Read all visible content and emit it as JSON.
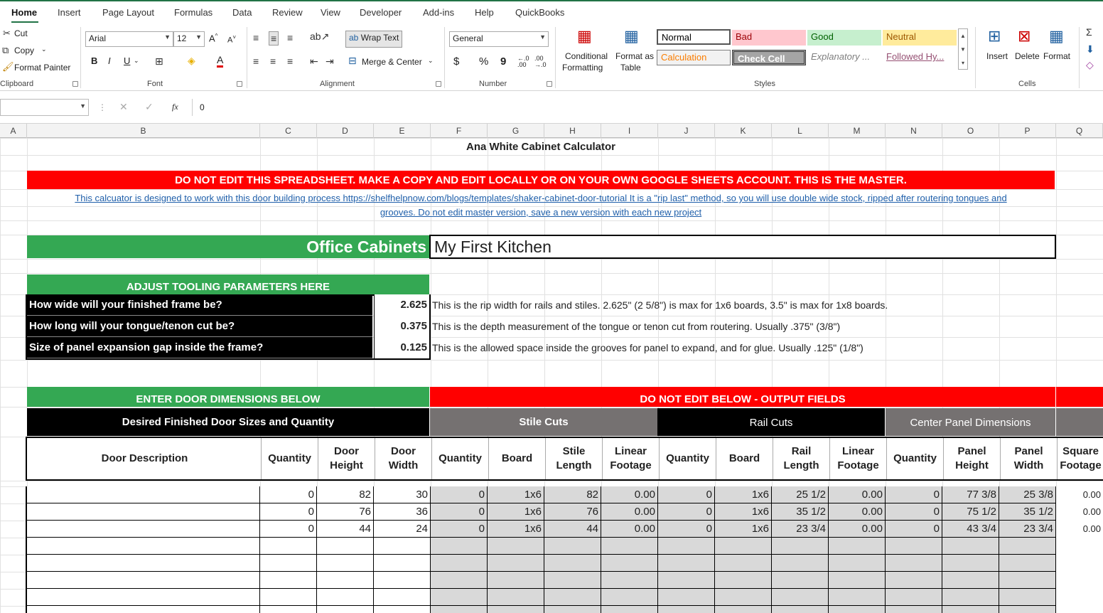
{
  "tabs": [
    "Home",
    "Insert",
    "Page Layout",
    "Formulas",
    "Data",
    "Review",
    "View",
    "Developer",
    "Add-ins",
    "Help",
    "QuickBooks"
  ],
  "ribbon": {
    "clipboard": {
      "cut": "Cut",
      "copy": "Copy",
      "format_painter": "Format Painter",
      "label": "Clipboard"
    },
    "font": {
      "name": "Arial",
      "size": "12",
      "bold": "B",
      "italic": "I",
      "underline": "U",
      "grow": "A^",
      "shrink": "A˅",
      "label": "Font"
    },
    "alignment": {
      "wrap": "Wrap Text",
      "merge": "Merge & Center",
      "label": "Alignment"
    },
    "number": {
      "format": "General",
      "currency": "$",
      "percent": "%",
      "comma": "9",
      "inc": "←.0 .00",
      "dec": ".00 →.0",
      "label": "Number"
    },
    "styles": {
      "cond_line1": "Conditional",
      "cond_line2": "Formatting",
      "table_line1": "Format as",
      "table_line2": "Table",
      "normal": "Normal",
      "bad": "Bad",
      "good": "Good",
      "neutral": "Neutral",
      "calculation": "Calculation",
      "check": "Check Cell",
      "explanatory": "Explanatory ...",
      "followed": "Followed Hy...",
      "label": "Styles"
    },
    "cells": {
      "insert": "Insert",
      "delete": "Delete",
      "format": "Format",
      "label": "Cells"
    }
  },
  "formula_bar": {
    "name_box": "",
    "fx": "fx",
    "value": "0"
  },
  "columns": [
    "A",
    "B",
    "C",
    "D",
    "E",
    "F",
    "G",
    "H",
    "I",
    "J",
    "K",
    "L",
    "M",
    "N",
    "O",
    "P",
    "Q"
  ],
  "sheet": {
    "title": "Ana White Cabinet Calculator",
    "warning": "DO NOT EDIT THIS SPREADSHEET. MAKE A COPY AND EDIT LOCALLY OR ON YOUR OWN GOOGLE SHEETS ACCOUNT. THIS IS THE MASTER.",
    "info_line1": "This calcuator is designed to work with this door building process https://shelfhelpnow.com/blogs/templates/shaker-cabinet-door-tutorial It is a \"rip last\" method, so you will use double wide stock, ripped after routering tongues and",
    "info_line2": "grooves. Do not edit master version, save a new version with each new project",
    "project_label": "Office Cabinets",
    "project_name": "My First Kitchen",
    "tooling_header": "ADJUST TOOLING PARAMETERS HERE",
    "params": [
      {
        "q": "How wide will your finished frame be?",
        "v": "2.625",
        "note": "This is the rip width for rails and stiles. 2.625\" (2 5/8\") is max for 1x6 boards, 3.5\" is max for 1x8 boards."
      },
      {
        "q": "How long will your tongue/tenon cut be?",
        "v": "0.375",
        "note": "This is the depth measurement of the tongue or tenon cut from routering. Usually .375\" (3/8\")"
      },
      {
        "q": "Size of panel expansion gap inside the frame?",
        "v": "0.125",
        "note": "This is the allowed space inside the grooves for panel to expand, and for glue. Usually .125\" (1/8\")"
      }
    ],
    "enter_header": "ENTER DOOR DIMENSIONS BELOW",
    "output_header": "DO NOT EDIT BELOW - OUTPUT FIELDS",
    "desired_header": "Desired Finished Door Sizes and Quantity",
    "stile_header": "Stile Cuts",
    "rail_header": "Rail Cuts",
    "panel_header": "Center Panel Dimensions",
    "col_headers": {
      "desc": "Door Description",
      "qty": "Quantity",
      "dh1": "Door",
      "dh2": "Height",
      "dw1": "Door",
      "dw2": "Width",
      "sq": "Quantity",
      "sb": "Board",
      "sl1": "Stile",
      "sl2": "Length",
      "lf1": "Linear",
      "lf2": "Footage",
      "rq": "Quantity",
      "rb": "Board",
      "rl1": "Rail",
      "rl2": "Length",
      "rf1": "Linear",
      "rf2": "Footage",
      "pq": "Quantity",
      "ph1": "Panel",
      "ph2": "Height",
      "pw1": "Panel",
      "pw2": "Width",
      "sf1": "Square",
      "sf2": "Footage"
    },
    "rows": [
      {
        "desc": "",
        "qty": "0",
        "dh": "82",
        "dw": "30",
        "sq": "0",
        "sb": "1x6",
        "sl": "82",
        "slf": "0.00",
        "rq": "0",
        "rb": "1x6",
        "rl": "25 1/2",
        "rlf": "0.00",
        "pq": "0",
        "ph": "77 3/8",
        "pw": "25 3/8",
        "sf": "0.00"
      },
      {
        "desc": "",
        "qty": "0",
        "dh": "76",
        "dw": "36",
        "sq": "0",
        "sb": "1x6",
        "sl": "76",
        "slf": "0.00",
        "rq": "0",
        "rb": "1x6",
        "rl": "35 1/2",
        "rlf": "0.00",
        "pq": "0",
        "ph": "75 1/2",
        "pw": "35 1/2",
        "sf": "0.00"
      },
      {
        "desc": "",
        "qty": "0",
        "dh": "44",
        "dw": "24",
        "sq": "0",
        "sb": "1x6",
        "sl": "44",
        "slf": "0.00",
        "rq": "0",
        "rb": "1x6",
        "rl": "23 3/4",
        "rlf": "0.00",
        "pq": "0",
        "ph": "43 3/4",
        "pw": "23 3/4",
        "sf": "0.00"
      }
    ]
  },
  "colors": {
    "excel_green": "#217346",
    "red": "#ff0000",
    "green": "#34a853",
    "black": "#000000",
    "grey_header": "#757171",
    "output_grey": "#d9d9d9"
  }
}
